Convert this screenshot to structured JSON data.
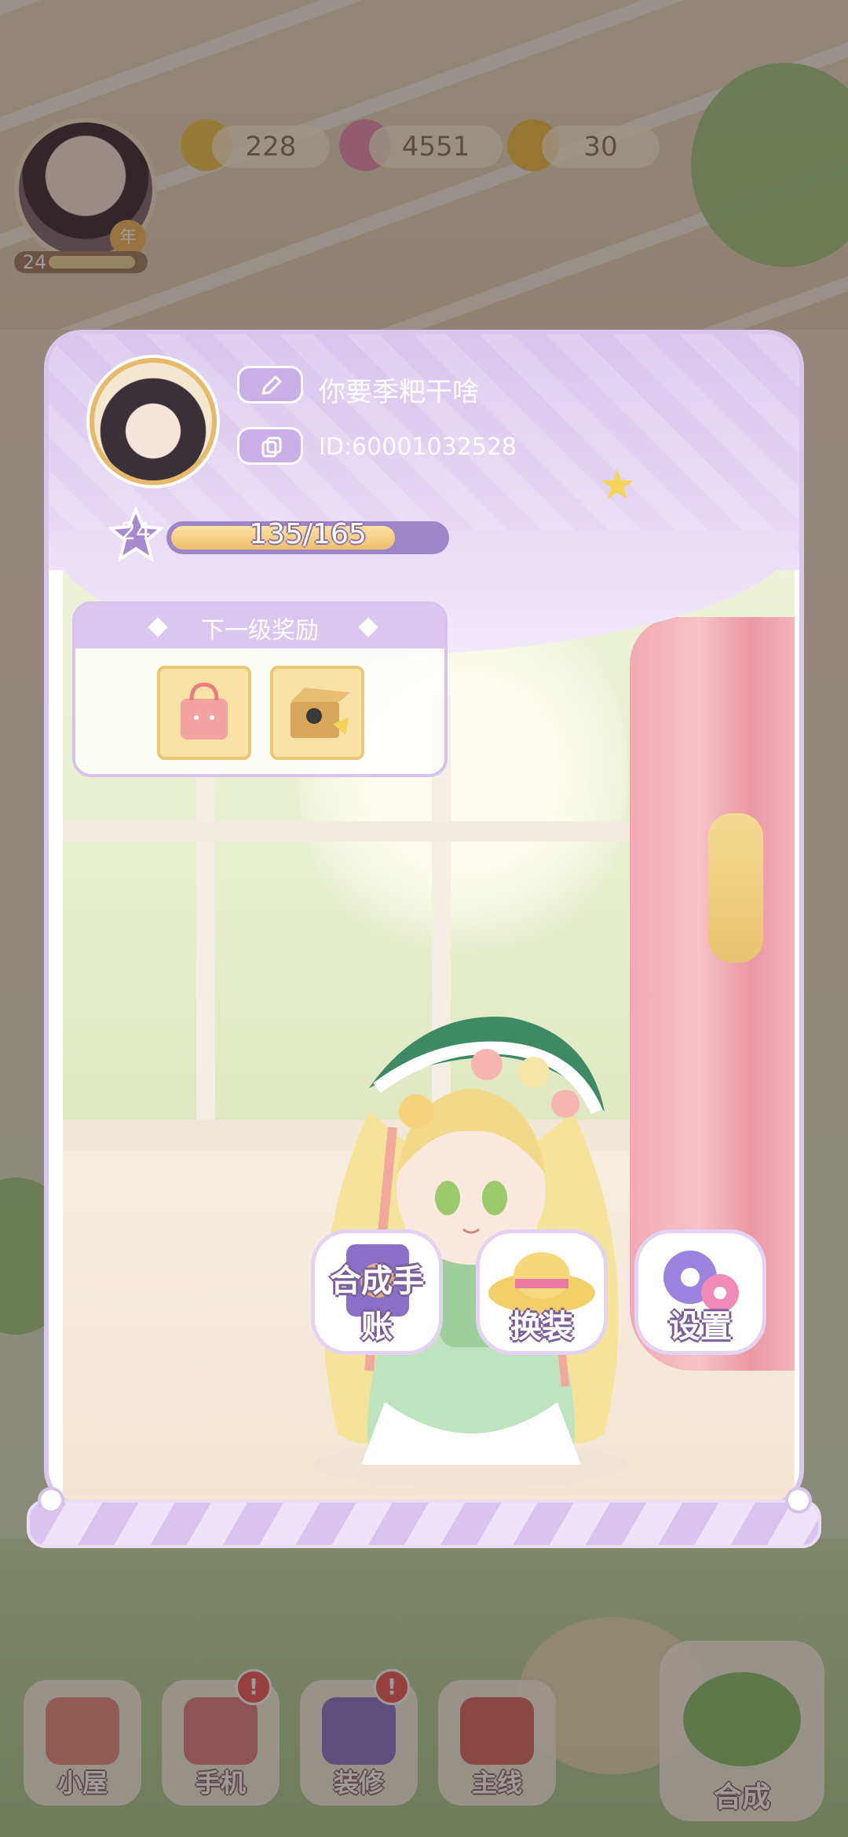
{
  "hud": {
    "player_level": "24",
    "year_badge": "年",
    "energy": "228",
    "gems": "4551",
    "coins": "30"
  },
  "profile": {
    "nickname": "你要季粑干啥",
    "user_id": "ID:60001032528",
    "level": "24",
    "xp_text": "135/165",
    "xp_fraction": 0.818
  },
  "reward": {
    "title": "下一级奖励"
  },
  "actions": {
    "handbook": "合成手账",
    "dressup": "换装",
    "settings": "设置"
  },
  "nav": {
    "home": "小屋",
    "phone": "手机",
    "decorate": "装修",
    "main_quest": "主线",
    "merge": "合成",
    "badge": "!"
  },
  "colors": {
    "panel_border": "#d9c6ec",
    "header_purple": "#d8c5ee",
    "xp_gold": "#efbf6b",
    "alert_red": "#f05a5a"
  }
}
